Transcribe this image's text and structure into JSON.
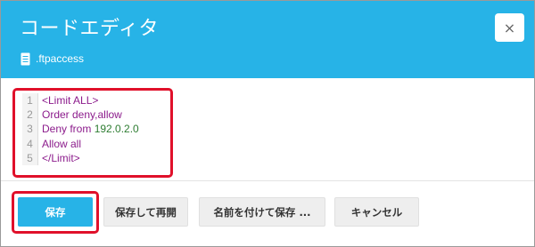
{
  "dialog": {
    "title": "コードエディタ",
    "file_name": ".ftpaccess",
    "close_symbol": "×"
  },
  "editor": {
    "lines": [
      {
        "number": "1",
        "text": "<Limit ALL>"
      },
      {
        "number": "2",
        "text": "Order deny,allow"
      },
      {
        "number": "3",
        "prefix": "Deny from ",
        "highlight": "192.0.2.0"
      },
      {
        "number": "4",
        "text": "Allow all"
      },
      {
        "number": "5",
        "text": "</Limit>"
      }
    ]
  },
  "buttons": {
    "save": "保存",
    "save_restart": "保存して再開",
    "save_as": "名前を付けて保存 ...",
    "cancel": "キャンセル"
  },
  "colors": {
    "header": "#27b3e7",
    "highlight_box": "#e0102a",
    "keyword": "#8c1c8c",
    "number": "#2e7d32"
  },
  "icons": {
    "file": "file-icon",
    "close": "close-icon"
  }
}
